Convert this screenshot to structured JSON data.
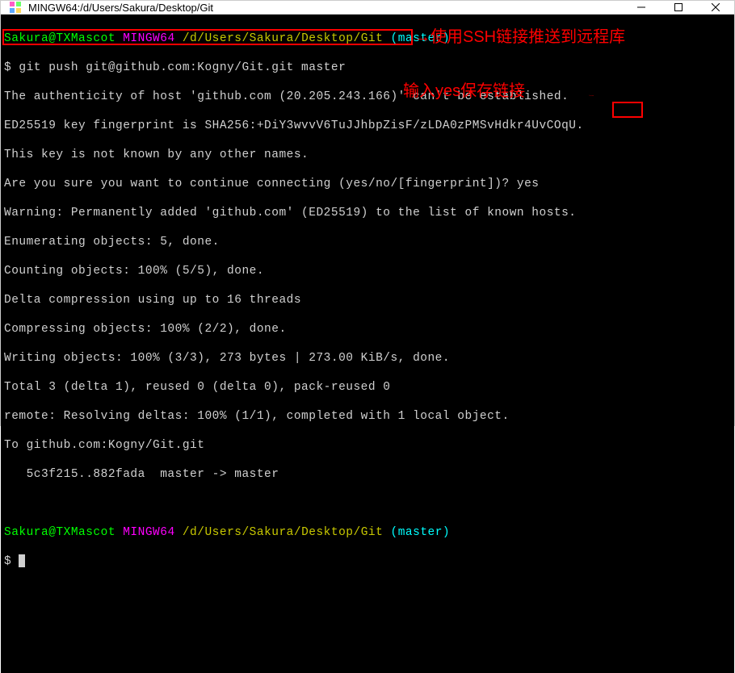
{
  "window": {
    "title": "MINGW64:/d/Users/Sakura/Desktop/Git"
  },
  "prompt1": {
    "user": "Sakura@TXMascot",
    "env": "MINGW64",
    "path": "/d/Users/Sakura/Desktop/Git",
    "branch": "(master)"
  },
  "command1": "$ git push git@github.com:Kogny/Git.git master",
  "output": {
    "l1": "The authenticity of host 'github.com (20.205.243.166)' can't be established.",
    "l2": "ED25519 key fingerprint is SHA256:+DiY3wvvV6TuJJhbpZisF/zLDA0zPMSvHdkr4UvCOqU.",
    "l3": "This key is not known by any other names.",
    "l4": "Are you sure you want to continue connecting (yes/no/[fingerprint])? yes",
    "l5": "Warning: Permanently added 'github.com' (ED25519) to the list of known hosts.",
    "l6": "Enumerating objects: 5, done.",
    "l7": "Counting objects: 100% (5/5), done.",
    "l8": "Delta compression using up to 16 threads",
    "l9": "Compressing objects: 100% (2/2), done.",
    "l10": "Writing objects: 100% (3/3), 273 bytes | 273.00 KiB/s, done.",
    "l11": "Total 3 (delta 1), reused 0 (delta 0), pack-reused 0",
    "l12": "remote: Resolving deltas: 100% (1/1), completed with 1 local object.",
    "l13": "To github.com:Kogny/Git.git",
    "l14": "   5c3f215..882fada  master -> master"
  },
  "prompt2": {
    "user": "Sakura@TXMascot",
    "env": "MINGW64",
    "path": "/d/Users/Sakura/Desktop/Git",
    "branch": "(master)",
    "dollar": "$ "
  },
  "annotations": {
    "a1": "→使用SSH链接推送到远程库",
    "a2": "输入yes保存链接"
  }
}
